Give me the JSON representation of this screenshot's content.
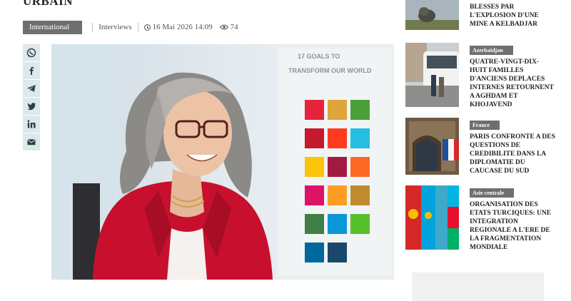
{
  "article": {
    "headline_tail": "URBAIN",
    "category": "International",
    "section": "Interviews",
    "date": "16 Mai 2026 14:09",
    "views": "74"
  },
  "share": {
    "buttons": [
      "whatsapp",
      "facebook",
      "telegram",
      "twitter",
      "linkedin",
      "email"
    ],
    "colors": {
      "button_bg": "#dde8ea",
      "icon": "#2a4048"
    }
  },
  "hero": {
    "poster_line_1": "17 GOALS TO",
    "poster_line_2": "TRANSFORM OUR WORLD"
  },
  "sidebar": {
    "items": [
      {
        "category": "",
        "title": "AZERBAIDJANAISE BLESSES PAR L'EXPLOSION D'UNE MINE A KELBADJAR"
      },
      {
        "category": "Azerbaidjan",
        "title": "QUATRE-VINGT-DIX-HUIT FAMILLES D'ANCIENS DEPLACES INTERNES RETOURNENT A AGHDAM ET KHOJAVEND"
      },
      {
        "category": "France",
        "title": "PARIS CONFRONTE A DES QUESTIONS DE CREDIBILITE DANS LA DIPLOMATIE DU CAUCASE DU SUD"
      },
      {
        "category": "Asie centrale",
        "title": "ORGANISATION DES ETATS TURCIQUES: UNE INTEGRATION REGIONALE A L'ERE DE LA FRAGMENTATION MONDIALE"
      }
    ]
  },
  "colors": {
    "badge": "#6f6f6f",
    "jacket": "#c8102e",
    "ad_box": "#f0f0f0"
  }
}
